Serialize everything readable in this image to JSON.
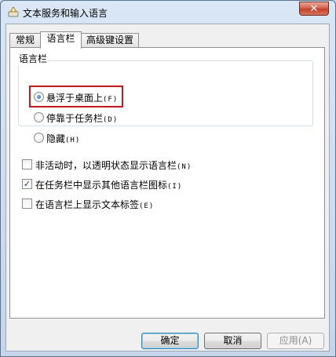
{
  "window": {
    "title": "文本服务和输入语言",
    "close_label": "✕"
  },
  "tabs": [
    {
      "label": "常规"
    },
    {
      "label": "语言栏"
    },
    {
      "label": "高级键设置"
    }
  ],
  "language_bar_group": {
    "label": "语言栏",
    "options": [
      {
        "label": "悬浮于桌面上",
        "accel": "(F)",
        "checked": true
      },
      {
        "label": "停靠于任务栏",
        "accel": "(D)",
        "checked": false
      },
      {
        "label": "隐藏",
        "accel": "(H)",
        "checked": false
      }
    ]
  },
  "checkboxes": [
    {
      "label": "非活动时，以透明状态显示语言栏",
      "accel": "(N)",
      "checked": false
    },
    {
      "label": "在任务栏中显示其他语言栏图标",
      "accel": "(I)",
      "checked": true
    },
    {
      "label": "在语言栏上显示文本标签",
      "accel": "(E)",
      "checked": false
    }
  ],
  "buttons": {
    "ok": "确定",
    "cancel": "取消",
    "apply": "应用(A)"
  },
  "check_mark": "✓",
  "colors": {
    "highlight": "#c01a1f",
    "title_bg": "#d9e6f5",
    "close_bg": "#c3402a"
  }
}
